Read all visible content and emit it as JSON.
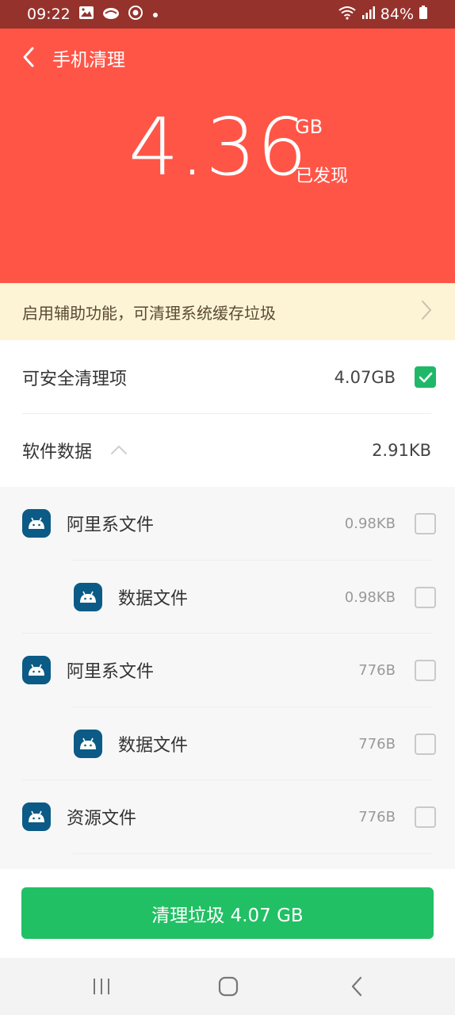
{
  "status_bar": {
    "time": "09:22",
    "battery": "84%"
  },
  "header": {
    "title": "手机清理",
    "amount": "4.36",
    "unit": "GB",
    "found_label": "已发现"
  },
  "notice": {
    "text": "启用辅助功能，可清理系统缓存垃圾"
  },
  "safe_section": {
    "label": "可安全清理项",
    "size": "4.07GB",
    "checked": true
  },
  "software_section": {
    "label": "软件数据",
    "size": "2.91KB"
  },
  "items": [
    {
      "name": "阿里系文件",
      "size": "0.98KB",
      "indent": 0
    },
    {
      "name": "数据文件",
      "size": "0.98KB",
      "indent": 1
    },
    {
      "name": "阿里系文件",
      "size": "776B",
      "indent": 0
    },
    {
      "name": "数据文件",
      "size": "776B",
      "indent": 1
    },
    {
      "name": "资源文件",
      "size": "776B",
      "indent": 0
    }
  ],
  "clean_button": {
    "label": "清理垃圾 4.07 GB"
  },
  "colors": {
    "header": "#ff5547",
    "status_bar": "#96322c",
    "accent_green": "#21c064",
    "notice_bg": "#fdf4d6"
  },
  "icons": [
    "gallery-icon",
    "cloud-icon",
    "target-icon",
    "wifi-icon",
    "signal-icon",
    "battery-icon",
    "back-icon",
    "chevron-right-icon",
    "chevron-up-icon",
    "android-app-icon",
    "recent-apps-icon",
    "home-icon",
    "nav-back-icon"
  ]
}
